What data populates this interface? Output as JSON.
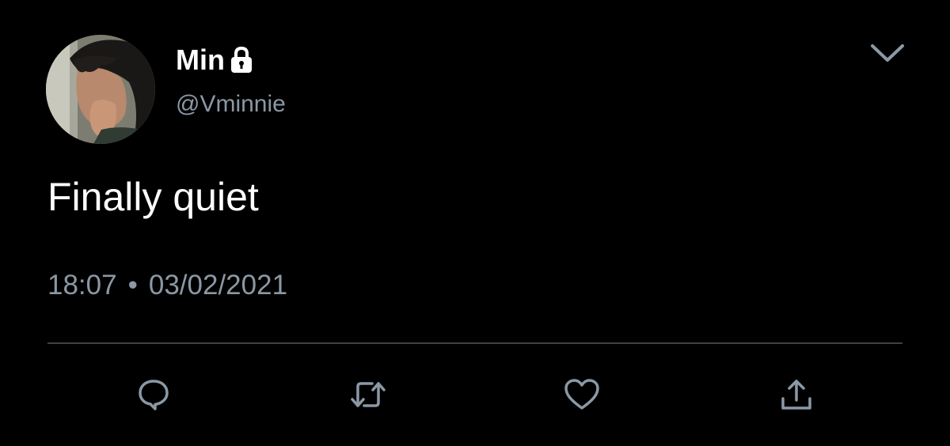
{
  "tweet": {
    "display_name": "Min",
    "handle": "@Vminnie",
    "text": "Finally quiet",
    "time": "18:07",
    "separator": "•",
    "date": "03/02/2021",
    "protected_icon": "lock-icon",
    "menu_icon": "chevron-down-icon"
  },
  "actions": [
    {
      "name": "reply",
      "icon": "reply-icon"
    },
    {
      "name": "retweet",
      "icon": "retweet-icon"
    },
    {
      "name": "like",
      "icon": "heart-icon"
    },
    {
      "name": "share",
      "icon": "share-icon"
    }
  ],
  "colors": {
    "background": "#000000",
    "text": "#ffffff",
    "secondary_text": "#8b98a5",
    "divider": "#3d4146",
    "icon": "#8b98a5"
  }
}
